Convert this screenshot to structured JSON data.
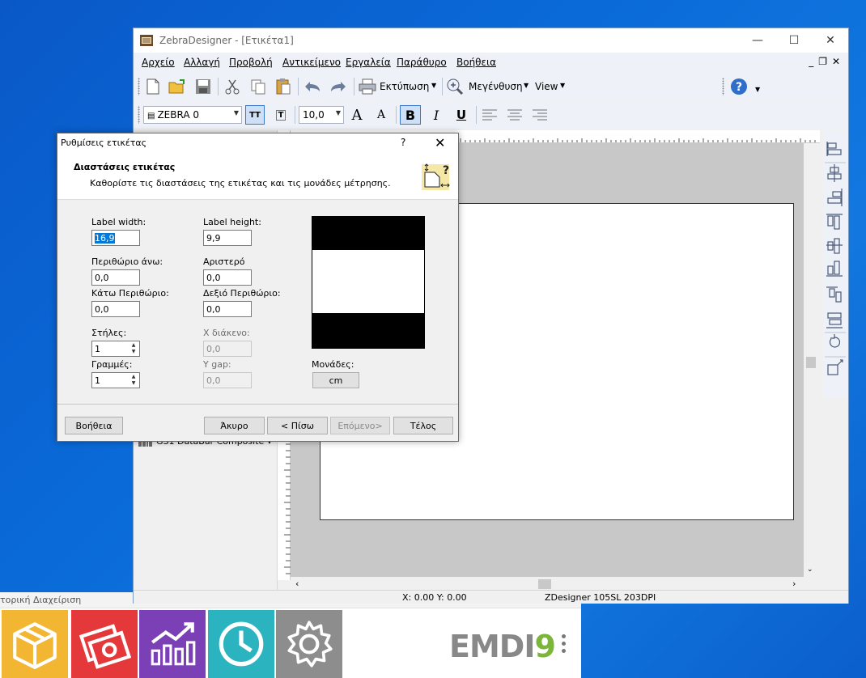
{
  "window": {
    "title": "ZebraDesigner - [Ετικέτα1]",
    "menu": [
      "Αρχείο",
      "Αλλαγή",
      "Προβολή",
      "Αντικείμενο",
      "Εργαλεία",
      "Παράθυρο",
      "Βοήθεια"
    ]
  },
  "toolbar": {
    "print_label": "Εκτύπωση",
    "zoom_label": "Μεγένθυση",
    "view_label": "View",
    "font_name": "ZEBRA 0",
    "font_size": "10,0",
    "bold": "B",
    "italic": "I",
    "underline": "U"
  },
  "left_panel": {
    "item_label": "GS1 DataBar Composite"
  },
  "status": {
    "coords": "X:  0.00 Y:   0.00",
    "printer": "ZDesigner 105SL 203DPI"
  },
  "dialog": {
    "title": "Ρυθμίσεις ετικέτας",
    "help_glyph": "?",
    "heading": "Διαστάσεις ετικέτας",
    "subheading": "Καθορίστε τις διαστάσεις της ετικέτας και τις μονάδες μέτρησης.",
    "fields": {
      "label_width_label": "Label width:",
      "label_width": "16,9",
      "label_height_label": "Label height:",
      "label_height": "9,9",
      "top_margin_label": "Περιθώριο άνω:",
      "top_margin": "0,0",
      "left_label": "Αριστερό",
      "left": "0,0",
      "bottom_margin_label": "Κάτω Περιθώριο:",
      "bottom_margin": "0,0",
      "right_margin_label": "Δεξιό Περιθώριο:",
      "right_margin": "0,0",
      "columns_label": "Στήλες:",
      "columns": "1",
      "x_gap_label": "X διάκενο:",
      "x_gap": "0,0",
      "rows_label": "Γραμμές:",
      "rows": "1",
      "y_gap_label": "Y gap:",
      "y_gap": "0,0",
      "units_label": "Μονάδες:",
      "units": "cm"
    },
    "buttons": {
      "help": "Βοήθεια",
      "cancel": "Άκυρο",
      "back": "< Πίσω",
      "next": "Επόμενο>",
      "finish": "Τέλος"
    }
  },
  "background_app": {
    "title_fragment": "τορική Διαχείριση",
    "brand_left": "EMDI",
    "brand_right": "9",
    "tile_colors": [
      "#f2b632",
      "#e5383b",
      "#7b3fb6",
      "#2bb3c0",
      "#8d8d8d"
    ]
  }
}
